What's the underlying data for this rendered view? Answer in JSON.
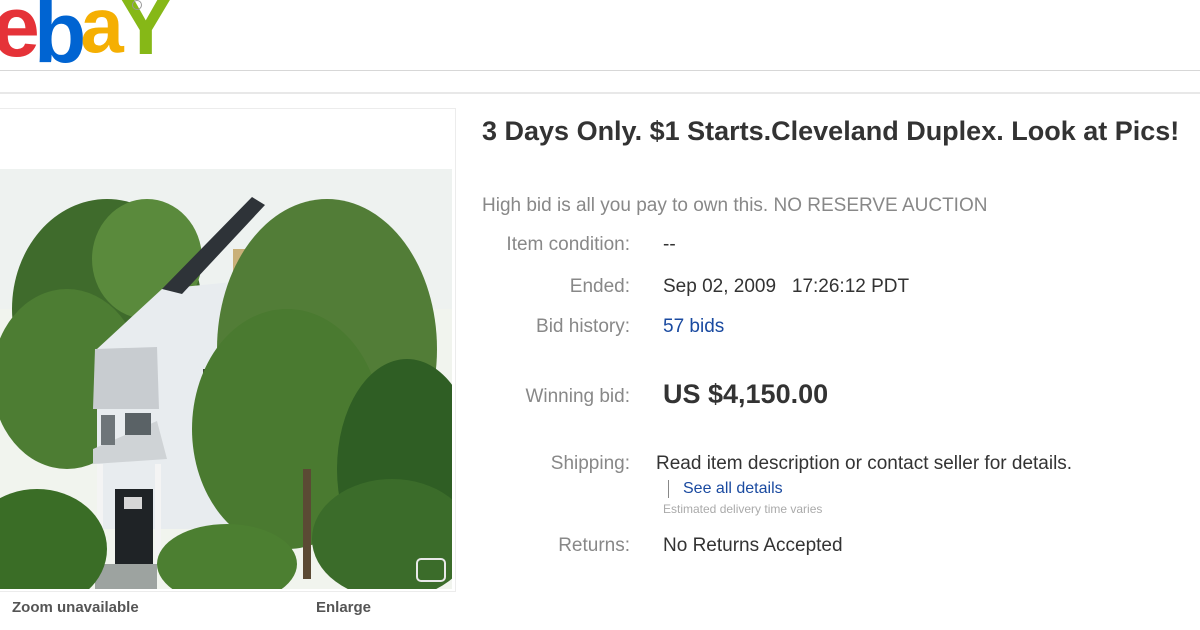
{
  "brand": {
    "logo_letters": [
      "e",
      "b",
      "a",
      "Y"
    ],
    "colors": {
      "e": "#e53238",
      "b": "#0064d2",
      "a": "#f5af02",
      "y": "#86b817"
    }
  },
  "picture": {
    "zoom_label": "Zoom unavailable",
    "enlarge_label": "Enlarge"
  },
  "listing": {
    "title": "3 Days Only. $1 Starts.Cleveland Duplex. Look at Pics!",
    "subtitle": "High bid is all you pay to own this. NO RESERVE AUCTION",
    "condition_label": "Item condition:",
    "condition_value": "--",
    "ended_label": "Ended:",
    "ended_value": "Sep 02, 2009   17:26:12 PDT",
    "bid_history_label": "Bid history:",
    "bid_history_value": "57 bids",
    "winning_bid_label": "Winning bid:",
    "winning_bid_value": "US $4,150.00",
    "shipping_label": "Shipping:",
    "shipping_value": "Read item description or contact seller for details.",
    "see_all_details": "See all details",
    "estimated_delivery": "Estimated delivery time varies",
    "returns_label": "Returns:",
    "returns_value": "No Returns Accepted"
  }
}
